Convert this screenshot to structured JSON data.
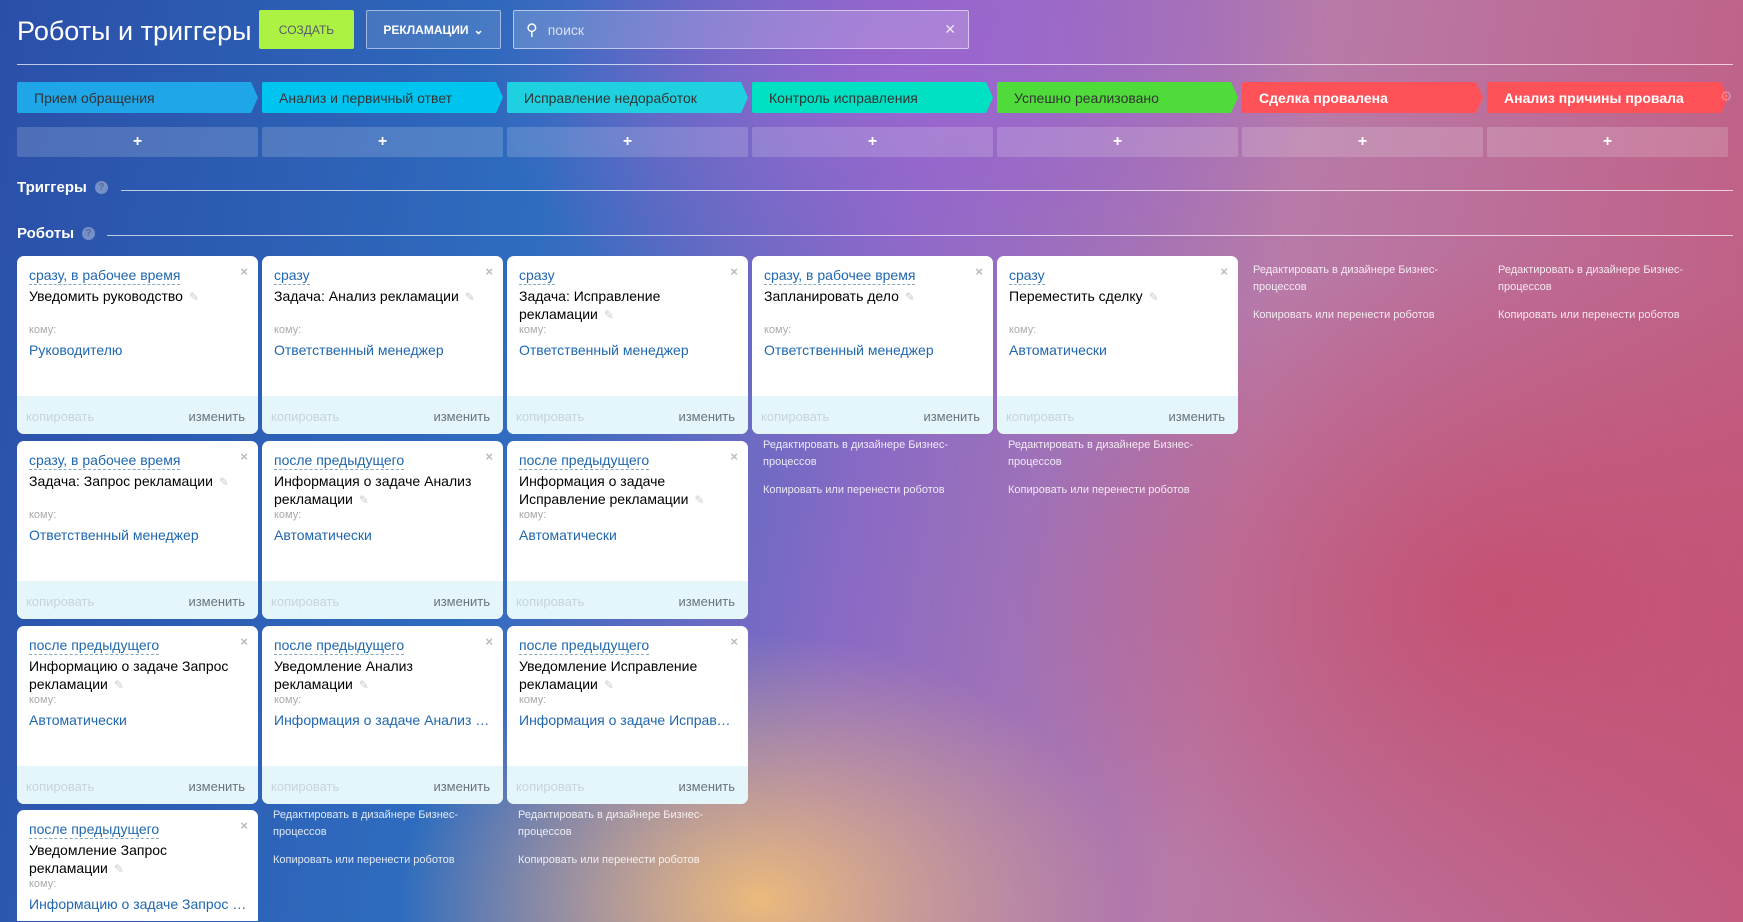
{
  "header": {
    "title": "Роботы и триггеры",
    "create_label": "СОЗДАТЬ",
    "filter_label": "РЕКЛАМАЦИИ",
    "search_placeholder": "поиск"
  },
  "stages": [
    {
      "label": "Прием обращения",
      "color": "#1fa6e8",
      "text": "#333"
    },
    {
      "label": "Анализ и первичный ответ",
      "color": "#00c4f0",
      "text": "#333"
    },
    {
      "label": "Исправление недоработок",
      "color": "#1fd1e0",
      "text": "#333"
    },
    {
      "label": "Контроль исправления",
      "color": "#00e1c4",
      "text": "#333"
    },
    {
      "label": "Успешно реализовано",
      "color": "#4fdc3a",
      "text": "#333"
    },
    {
      "label": "Сделка провалена",
      "color": "#ff5258",
      "text": "#fff"
    },
    {
      "label": "Анализ причины провала",
      "color": "#ff5258",
      "text": "#fff"
    }
  ],
  "add_label": "+",
  "sections": {
    "triggers": "Триггеры",
    "robots": "Роботы",
    "help": "?"
  },
  "card_labels": {
    "to": "кому:",
    "copy": "копировать",
    "edit": "изменить",
    "close": "×",
    "pencil": "✎"
  },
  "links": {
    "edit_designer": "Редактировать в дизайнере Бизнес-процессов",
    "copy_move": "Копировать или перенести роботов"
  },
  "columns": [
    [
      {
        "trigger": "сразу, в рабочее время",
        "name": "Уведомить руководство",
        "recipient": "Руководителю"
      },
      {
        "trigger": "сразу, в рабочее время",
        "name": "Задача: Запрос рекламации",
        "recipient": "Ответственный менеджер"
      },
      {
        "trigger": "после предыдущего",
        "name": "Информацию о задаче Запрос рекламации",
        "recipient": "Автоматически"
      },
      {
        "trigger": "после предыдущего",
        "name": "Уведомление Запрос рекламации",
        "recipient": "Информацию о задаче Запрос рекламации"
      }
    ],
    [
      {
        "trigger": "сразу",
        "name": "Задача: Анализ рекламации",
        "recipient": "Ответственный менеджер"
      },
      {
        "trigger": "после предыдущего",
        "name": "Информация о задаче Анализ рекламации",
        "recipient": "Автоматически"
      },
      {
        "trigger": "после предыдущего",
        "name": "Уведомление Анализ рекламации",
        "recipient": "Информация о задаче Анализ рекламации"
      }
    ],
    [
      {
        "trigger": "сразу",
        "name": "Задача: Исправление рекламации",
        "recipient": "Ответственный менеджер"
      },
      {
        "trigger": "после предыдущего",
        "name": "Информация о задаче Исправление рекламации",
        "recipient": "Автоматически"
      },
      {
        "trigger": "после предыдущего",
        "name": "Уведомление Исправление рекламации",
        "recipient": "Информация о задаче Исправление рекламации"
      }
    ],
    [
      {
        "trigger": "сразу, в рабочее время",
        "name": "Запланировать дело",
        "recipient": "Ответственный менеджер"
      }
    ],
    [
      {
        "trigger": "сразу",
        "name": "Переместить сделку",
        "recipient": "Автоматически"
      }
    ],
    [],
    []
  ]
}
